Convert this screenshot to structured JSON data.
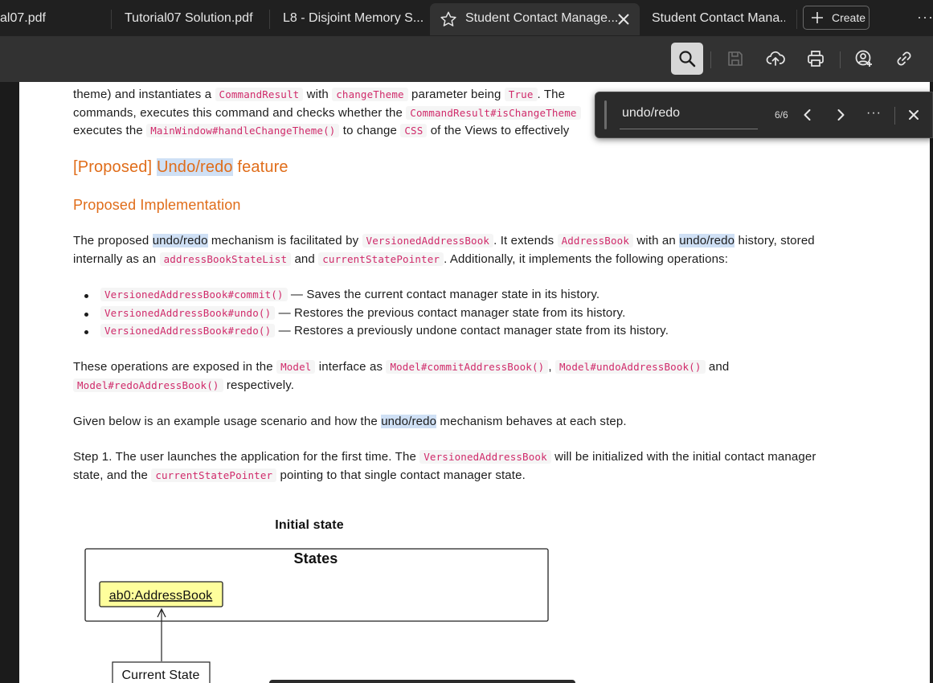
{
  "tabs": [
    {
      "label": "al07.pdf"
    },
    {
      "label": "Tutorial07 Solution.pdf"
    },
    {
      "label": "L8 - Disjoint Memory S..."
    },
    {
      "label": "Student Contact Manage...",
      "active": true
    },
    {
      "label": "Student Contact Mana..."
    }
  ],
  "create_label": "Create",
  "more_label": "···",
  "toolbar": {
    "icons": [
      "search-icon",
      "save-icon",
      "upload-icon",
      "print-icon",
      "share-icon",
      "link-icon"
    ]
  },
  "find": {
    "query": "undo/redo",
    "count": "6/6",
    "more": "···"
  },
  "doc": {
    "l1": {
      "a": "theme) and instantiates a ",
      "c1": "CommandResult",
      "b": " with ",
      "c2": "changeTheme",
      "d": " parameter being ",
      "c3": "True",
      "e": ". The "
    },
    "l2": {
      "a": "commands, executes this command and checks whether the ",
      "c1": "CommandResult#isChangeTheme"
    },
    "l3": {
      "a": "executes the ",
      "c1": "MainWindow#handleChangeTheme()",
      "b": " to change ",
      "c2": "CSS",
      "d": " of the Views to effectively"
    },
    "h2": {
      "a": "[Proposed] ",
      "hl": "Undo/redo",
      "b": " feature"
    },
    "h3": "Proposed Implementation",
    "p1": {
      "a": "The proposed ",
      "hl1": "undo/redo",
      "b": " mechanism is facilitated by ",
      "c1": "VersionedAddressBook",
      "d": ". It extends ",
      "c2": "AddressBook",
      "e": " with an ",
      "hl2": "undo/redo",
      "f": " history, stored"
    },
    "p2": {
      "a": "internally as an ",
      "c1": "addressBookStateList",
      "b": " and ",
      "c2": "currentStatePointer",
      "d": ". Additionally, it implements the following operations:"
    },
    "bullets": [
      {
        "code": "VersionedAddressBook#commit()",
        "text": " — Saves the current contact manager state in its history."
      },
      {
        "code": "VersionedAddressBook#undo()",
        "text": " — Restores the previous contact manager state from its history."
      },
      {
        "code": "VersionedAddressBook#redo()",
        "text": " — Restores a previously undone contact manager state from its history."
      }
    ],
    "p3": {
      "a": "These operations are exposed in the ",
      "c1": "Model",
      "b": " interface as ",
      "c2": "Model#commitAddressBook()",
      "d": ", ",
      "c3": "Model#undoAddressBook()",
      "e": " and"
    },
    "p4": {
      "c1": "Model#redoAddressBook()",
      "a": " respectively."
    },
    "p5": {
      "a": "Given below is an example usage scenario and how the ",
      "hl": "undo/redo",
      "b": " mechanism behaves at each step."
    },
    "p6": {
      "a": "Step 1. The user launches the application for the first time. The ",
      "c1": "VersionedAddressBook",
      "b": " will be initialized with the initial contact manager"
    },
    "p7": {
      "a": "state, and the ",
      "c1": "currentStatePointer",
      "b": " pointing to that single contact manager state."
    }
  },
  "diagram": {
    "title": "Initial state",
    "frame": "States",
    "node": "ab0:AddressBook",
    "pointer": "Current State"
  },
  "colors": {
    "heading": "#e06d1a",
    "code": "#d02a6a",
    "highlight": "#cfe0f5",
    "node_fill": "#fefe9c"
  }
}
